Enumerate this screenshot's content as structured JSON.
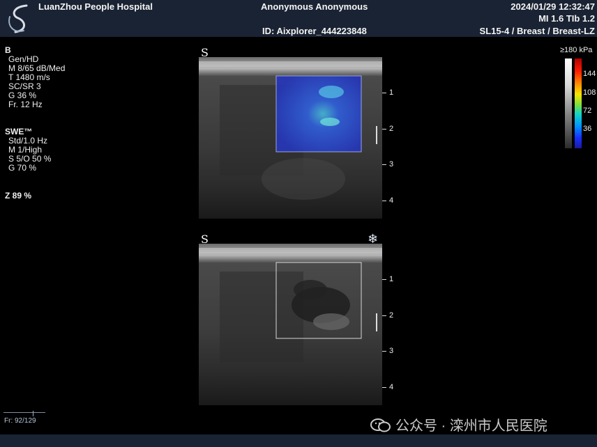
{
  "header": {
    "hospital": "LuanZhou People Hospital",
    "patient": "Anonymous Anonymous",
    "patient_id": "ID: Aixplorer_444223848",
    "datetime": "2024/01/29 12:32:47",
    "mi_tib": "MI 1.6  TIb  1.2",
    "preset": "SL15-4 / Breast / Breast-LZ"
  },
  "params": {
    "b_mode": {
      "title": "B",
      "items": [
        "Gen/HD",
        "M 8/65 dB/Med",
        "T 1480 m/s",
        "SC/SR 3",
        "G 36 %",
        "Fr. 12 Hz"
      ]
    },
    "swe": {
      "title": "SWE™",
      "items": [
        "Std/1.0 Hz",
        "M 1/High",
        "S 5/O 50 %",
        "G 70 %"
      ]
    },
    "zoom": "Z   89  %"
  },
  "images": {
    "top_probe_mark": "S",
    "bottom_probe_mark": "S",
    "freeze_icon": "snowflake-icon",
    "freeze_glyph": "❄",
    "depth_labels": [
      "1",
      "2",
      "3",
      "4"
    ]
  },
  "colorbar": {
    "max_label": "≥180 kPa",
    "labels": [
      "144",
      "108",
      "72",
      "36"
    ]
  },
  "footer": {
    "frame": "Fr: 92/129",
    "watermark": "公众号 · 滦州市人民医院"
  }
}
